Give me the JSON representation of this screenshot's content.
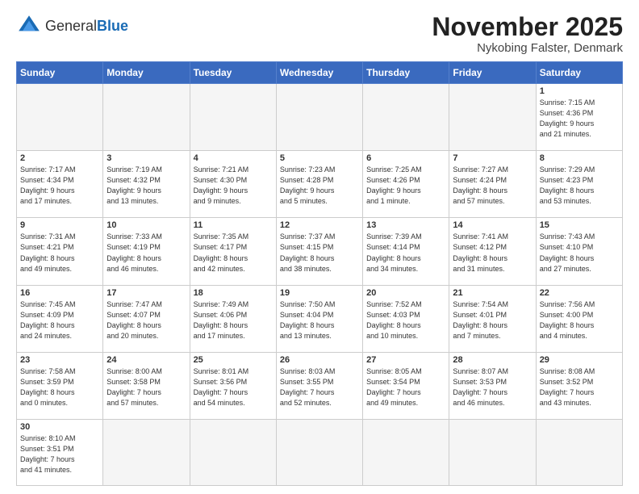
{
  "logo": {
    "general": "General",
    "blue": "Blue"
  },
  "title": "November 2025",
  "subtitle": "Nykobing Falster, Denmark",
  "days_header": [
    "Sunday",
    "Monday",
    "Tuesday",
    "Wednesday",
    "Thursday",
    "Friday",
    "Saturday"
  ],
  "weeks": [
    [
      {
        "day": "",
        "info": ""
      },
      {
        "day": "",
        "info": ""
      },
      {
        "day": "",
        "info": ""
      },
      {
        "day": "",
        "info": ""
      },
      {
        "day": "",
        "info": ""
      },
      {
        "day": "",
        "info": ""
      },
      {
        "day": "1",
        "info": "Sunrise: 7:15 AM\nSunset: 4:36 PM\nDaylight: 9 hours\nand 21 minutes."
      }
    ],
    [
      {
        "day": "2",
        "info": "Sunrise: 7:17 AM\nSunset: 4:34 PM\nDaylight: 9 hours\nand 17 minutes."
      },
      {
        "day": "3",
        "info": "Sunrise: 7:19 AM\nSunset: 4:32 PM\nDaylight: 9 hours\nand 13 minutes."
      },
      {
        "day": "4",
        "info": "Sunrise: 7:21 AM\nSunset: 4:30 PM\nDaylight: 9 hours\nand 9 minutes."
      },
      {
        "day": "5",
        "info": "Sunrise: 7:23 AM\nSunset: 4:28 PM\nDaylight: 9 hours\nand 5 minutes."
      },
      {
        "day": "6",
        "info": "Sunrise: 7:25 AM\nSunset: 4:26 PM\nDaylight: 9 hours\nand 1 minute."
      },
      {
        "day": "7",
        "info": "Sunrise: 7:27 AM\nSunset: 4:24 PM\nDaylight: 8 hours\nand 57 minutes."
      },
      {
        "day": "8",
        "info": "Sunrise: 7:29 AM\nSunset: 4:23 PM\nDaylight: 8 hours\nand 53 minutes."
      }
    ],
    [
      {
        "day": "9",
        "info": "Sunrise: 7:31 AM\nSunset: 4:21 PM\nDaylight: 8 hours\nand 49 minutes."
      },
      {
        "day": "10",
        "info": "Sunrise: 7:33 AM\nSunset: 4:19 PM\nDaylight: 8 hours\nand 46 minutes."
      },
      {
        "day": "11",
        "info": "Sunrise: 7:35 AM\nSunset: 4:17 PM\nDaylight: 8 hours\nand 42 minutes."
      },
      {
        "day": "12",
        "info": "Sunrise: 7:37 AM\nSunset: 4:15 PM\nDaylight: 8 hours\nand 38 minutes."
      },
      {
        "day": "13",
        "info": "Sunrise: 7:39 AM\nSunset: 4:14 PM\nDaylight: 8 hours\nand 34 minutes."
      },
      {
        "day": "14",
        "info": "Sunrise: 7:41 AM\nSunset: 4:12 PM\nDaylight: 8 hours\nand 31 minutes."
      },
      {
        "day": "15",
        "info": "Sunrise: 7:43 AM\nSunset: 4:10 PM\nDaylight: 8 hours\nand 27 minutes."
      }
    ],
    [
      {
        "day": "16",
        "info": "Sunrise: 7:45 AM\nSunset: 4:09 PM\nDaylight: 8 hours\nand 24 minutes."
      },
      {
        "day": "17",
        "info": "Sunrise: 7:47 AM\nSunset: 4:07 PM\nDaylight: 8 hours\nand 20 minutes."
      },
      {
        "day": "18",
        "info": "Sunrise: 7:49 AM\nSunset: 4:06 PM\nDaylight: 8 hours\nand 17 minutes."
      },
      {
        "day": "19",
        "info": "Sunrise: 7:50 AM\nSunset: 4:04 PM\nDaylight: 8 hours\nand 13 minutes."
      },
      {
        "day": "20",
        "info": "Sunrise: 7:52 AM\nSunset: 4:03 PM\nDaylight: 8 hours\nand 10 minutes."
      },
      {
        "day": "21",
        "info": "Sunrise: 7:54 AM\nSunset: 4:01 PM\nDaylight: 8 hours\nand 7 minutes."
      },
      {
        "day": "22",
        "info": "Sunrise: 7:56 AM\nSunset: 4:00 PM\nDaylight: 8 hours\nand 4 minutes."
      }
    ],
    [
      {
        "day": "23",
        "info": "Sunrise: 7:58 AM\nSunset: 3:59 PM\nDaylight: 8 hours\nand 0 minutes."
      },
      {
        "day": "24",
        "info": "Sunrise: 8:00 AM\nSunset: 3:58 PM\nDaylight: 7 hours\nand 57 minutes."
      },
      {
        "day": "25",
        "info": "Sunrise: 8:01 AM\nSunset: 3:56 PM\nDaylight: 7 hours\nand 54 minutes."
      },
      {
        "day": "26",
        "info": "Sunrise: 8:03 AM\nSunset: 3:55 PM\nDaylight: 7 hours\nand 52 minutes."
      },
      {
        "day": "27",
        "info": "Sunrise: 8:05 AM\nSunset: 3:54 PM\nDaylight: 7 hours\nand 49 minutes."
      },
      {
        "day": "28",
        "info": "Sunrise: 8:07 AM\nSunset: 3:53 PM\nDaylight: 7 hours\nand 46 minutes."
      },
      {
        "day": "29",
        "info": "Sunrise: 8:08 AM\nSunset: 3:52 PM\nDaylight: 7 hours\nand 43 minutes."
      }
    ],
    [
      {
        "day": "30",
        "info": "Sunrise: 8:10 AM\nSunset: 3:51 PM\nDaylight: 7 hours\nand 41 minutes."
      },
      {
        "day": "",
        "info": ""
      },
      {
        "day": "",
        "info": ""
      },
      {
        "day": "",
        "info": ""
      },
      {
        "day": "",
        "info": ""
      },
      {
        "day": "",
        "info": ""
      },
      {
        "day": "",
        "info": ""
      }
    ]
  ]
}
